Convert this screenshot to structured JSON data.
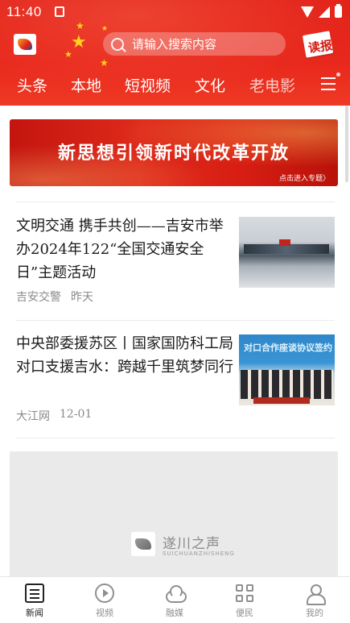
{
  "status_bar": {
    "time": "11:40"
  },
  "header": {
    "search_placeholder": "请输入搜索内容",
    "read_paper_label": "读报",
    "tabs": [
      "头条",
      "本地",
      "短视频",
      "文化",
      "老电影"
    ]
  },
  "banner": {
    "title": "新思想引领新时代改革开放",
    "cta": "点击进入专题〉"
  },
  "articles": [
    {
      "title": "文明交通 携手共创——吉安市举办2024年122“全国交通安全日”主题活动",
      "source": "吉安交警",
      "time": "昨天"
    },
    {
      "title": "中央部委援苏区丨国家国防科工局对口支援吉水：跨越千里筑梦同行",
      "source": "大江网",
      "time": "12-01",
      "thumb_caption": "对口合作座谈协议签约"
    }
  ],
  "video_placeholder": {
    "brand": "遂川之声",
    "brand_pinyin": "SUICHUANZHISHENG"
  },
  "bottom_nav": [
    {
      "label": "新闻",
      "icon": "news-icon",
      "active": true
    },
    {
      "label": "视频",
      "icon": "play-circle-icon",
      "active": false
    },
    {
      "label": "融媒",
      "icon": "cloud-icon",
      "active": false
    },
    {
      "label": "便民",
      "icon": "grid-icon",
      "active": false
    },
    {
      "label": "我的",
      "icon": "user-icon",
      "active": false
    }
  ],
  "colors": {
    "brand_red": "#e2231a",
    "nav_active": "#222222",
    "nav_inactive": "#8f8f8f"
  }
}
